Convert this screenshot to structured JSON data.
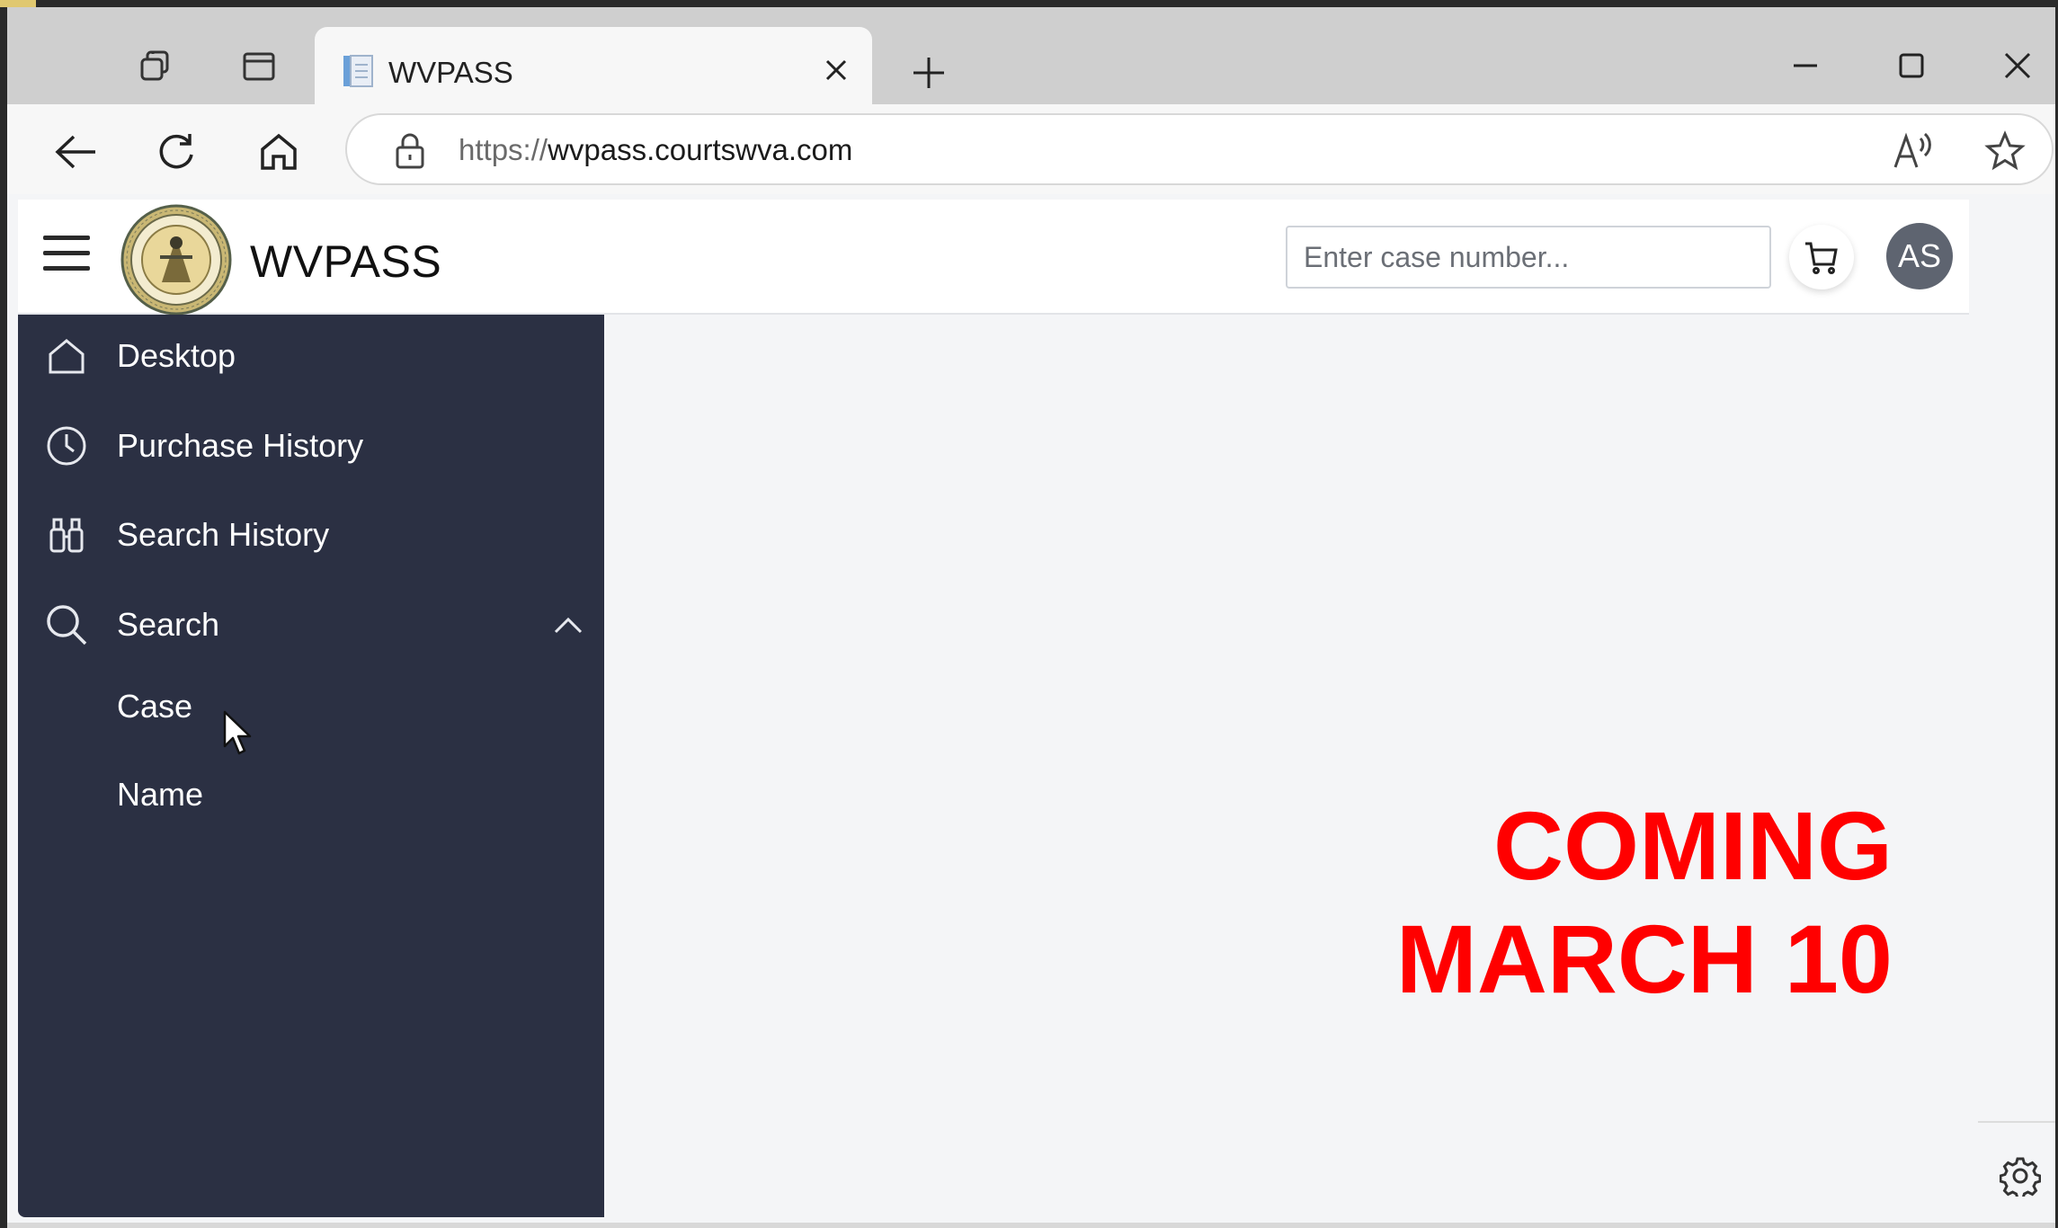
{
  "browser": {
    "tab_title": "WVPASS",
    "url_protocol": "https://",
    "url_host": "wvpass.courtswva.com",
    "icons": [
      "workspaces-icon",
      "vertical-tabs-icon",
      "tab-close-icon",
      "new-tab-icon",
      "minimize-icon",
      "maximize-icon",
      "window-close-icon",
      "back-icon",
      "refresh-icon",
      "home-icon",
      "lock-icon",
      "read-aloud-icon",
      "favorite-icon",
      "settings-icon"
    ]
  },
  "header": {
    "brand": "WVPASS",
    "search_placeholder": "Enter case number...",
    "avatar_initials": "AS"
  },
  "sidebar": {
    "items": [
      {
        "label": "Desktop",
        "icon": "home-icon"
      },
      {
        "label": "Purchase History",
        "icon": "clock-icon"
      },
      {
        "label": "Search History",
        "icon": "binoculars-icon"
      },
      {
        "label": "Search",
        "icon": "search-icon",
        "expanded": true
      }
    ],
    "subitems": [
      {
        "label": "Case"
      },
      {
        "label": "Name"
      }
    ]
  },
  "main": {
    "line1": "COMING",
    "line2": "MARCH 10"
  },
  "colors": {
    "sidebar_bg": "#2b3043",
    "announcement": "#ff0000",
    "avatar_bg": "#5e6470"
  }
}
